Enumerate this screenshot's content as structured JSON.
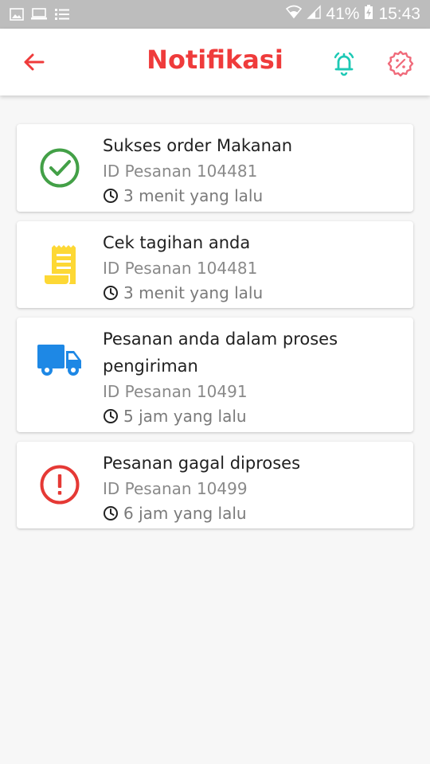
{
  "status_bar": {
    "battery": "41%",
    "time": "15:43"
  },
  "header": {
    "title": "Notifikasi",
    "accent_color": "#ef3b3b"
  },
  "notifications": [
    {
      "title": "Sukses order Makanan",
      "order_id": "ID Pesanan 104481",
      "time": "3 menit yang lalu",
      "icon": "check-circle-icon",
      "color": "#43a047"
    },
    {
      "title": "Cek tagihan anda",
      "order_id": "ID Pesanan 104481",
      "time": "3 menit yang lalu",
      "icon": "receipt-icon",
      "color": "#fdd835"
    },
    {
      "title": "Pesanan anda dalam proses pengiriman",
      "order_id": "ID Pesanan 10491",
      "time": "5 jam yang lalu",
      "icon": "truck-icon",
      "color": "#1e88e5"
    },
    {
      "title": "Pesanan gagal diproses",
      "order_id": "ID Pesanan 10499",
      "time": "6 jam yang lalu",
      "icon": "error-circle-icon",
      "color": "#e53935"
    }
  ]
}
